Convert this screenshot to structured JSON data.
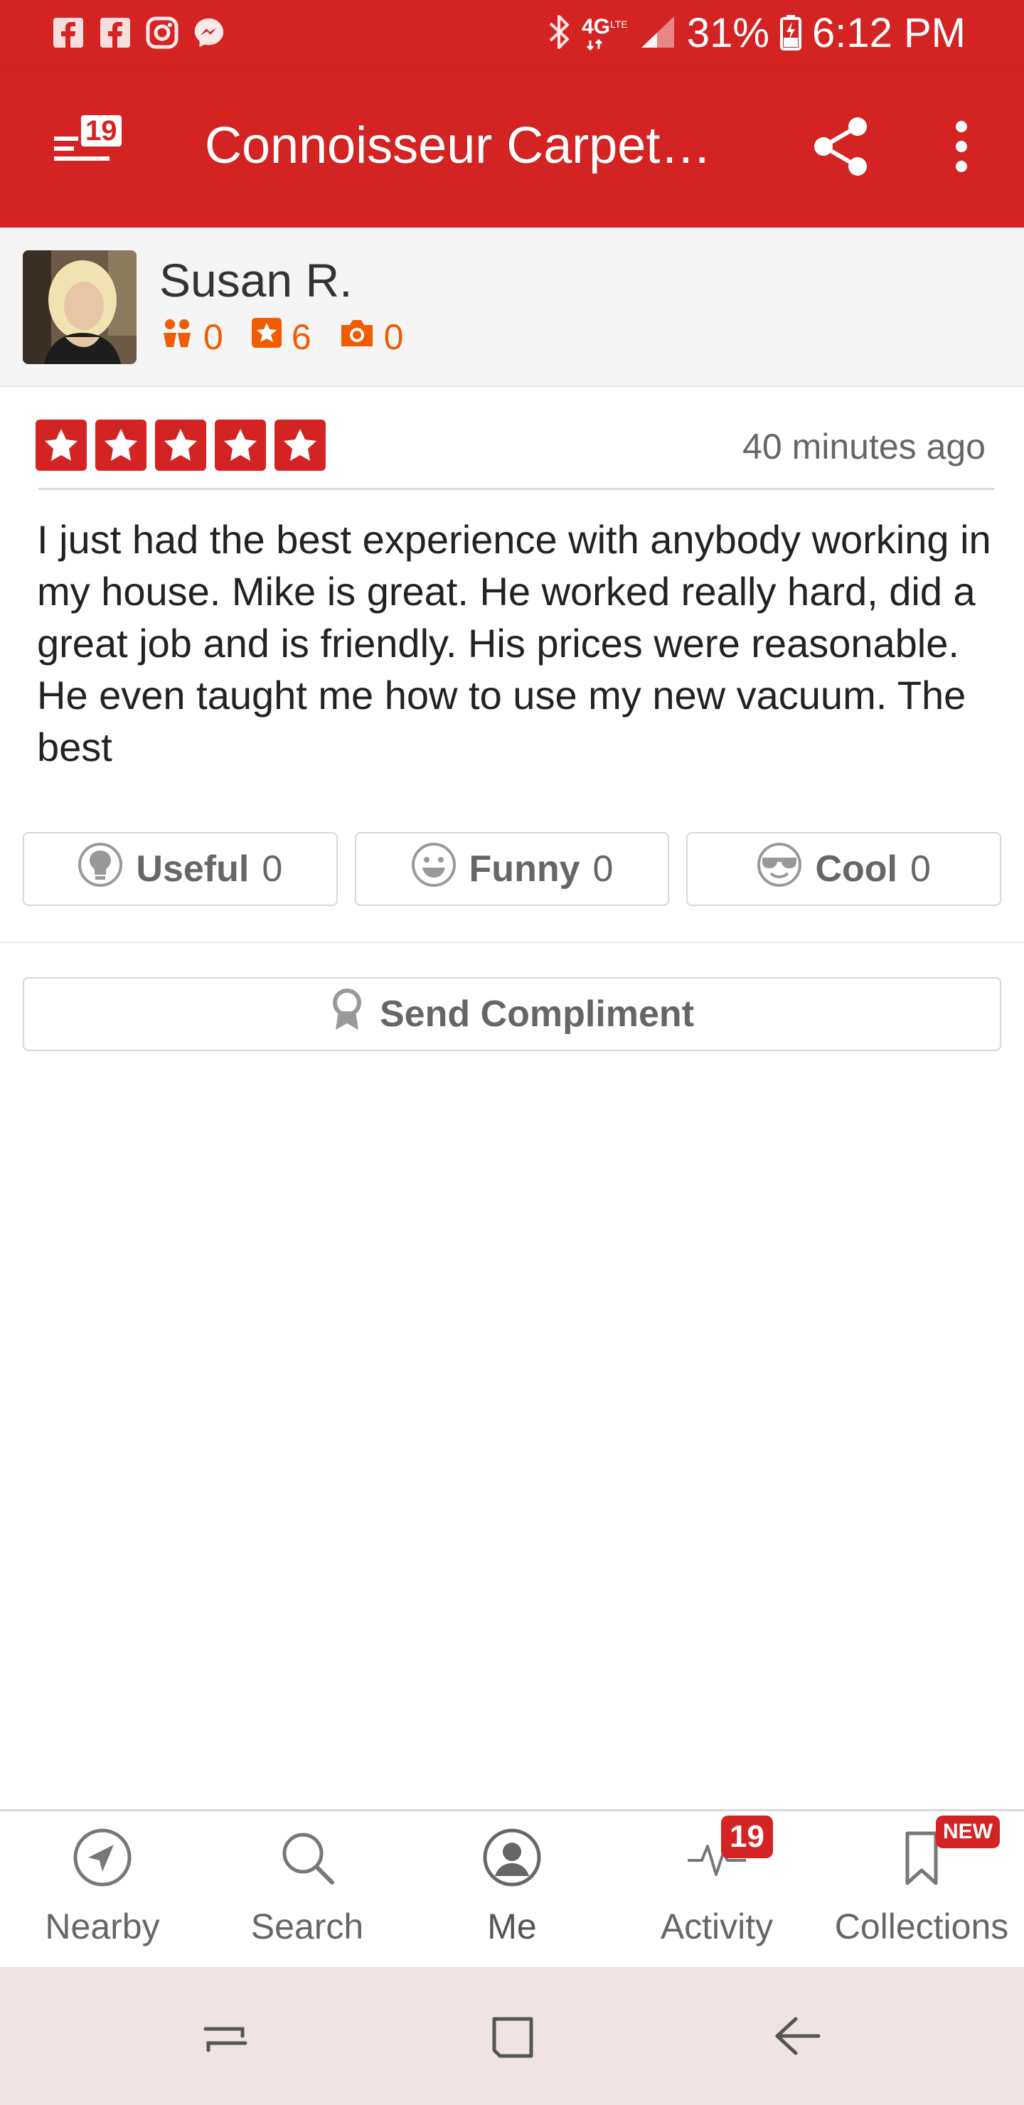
{
  "status_bar": {
    "battery": "31%",
    "time": "6:12 PM",
    "network": "4G LTE",
    "icons_left": [
      "facebook-icon",
      "facebook-icon",
      "instagram-icon",
      "messenger-icon"
    ]
  },
  "app_bar": {
    "menu_badge": "19",
    "title": "Connoisseur Carpet…"
  },
  "user": {
    "name": "Susan R.",
    "friends": "0",
    "reviews": "6",
    "photos": "0"
  },
  "review": {
    "rating": 5,
    "time": "40 minutes ago",
    "text": "I just had the best experience with anybody working in my house.  Mike is great.  He worked really hard, did a great job and is friendly.  His prices were reasonable.  He even taught me how to use my new vacuum.  The best"
  },
  "votes": {
    "useful_label": "Useful",
    "useful_count": "0",
    "funny_label": "Funny",
    "funny_count": "0",
    "cool_label": "Cool",
    "cool_count": "0"
  },
  "compliment_label": "Send Compliment",
  "bottom_nav": {
    "nearby": "Nearby",
    "search": "Search",
    "me": "Me",
    "activity": "Activity",
    "activity_badge": "19",
    "collections": "Collections",
    "collections_badge": "NEW"
  },
  "colors": {
    "brand_red": "#d32323",
    "stat_orange": "#f15c00"
  }
}
